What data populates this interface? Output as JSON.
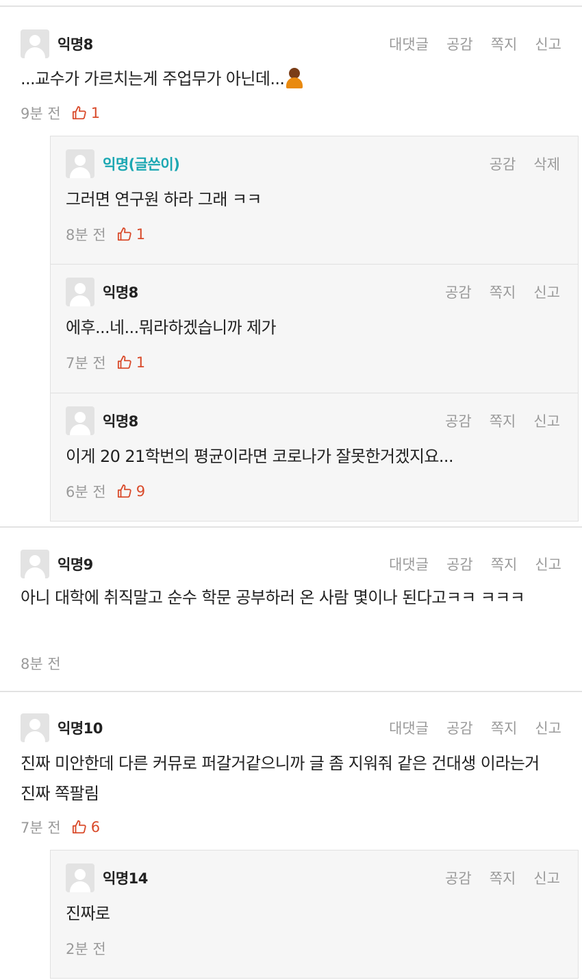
{
  "comments": [
    {
      "author": "익명8",
      "actions": [
        "대댓글",
        "공감",
        "쪽지",
        "신고"
      ],
      "text": "...교수가 가르치는게 주업무가 아닌데...",
      "emoji": "person-shrugging-emoji",
      "time": "9분 전",
      "likes": "1",
      "replies": [
        {
          "author": "익명(글쓴이)",
          "actions": [
            "공감",
            "삭제"
          ],
          "text": "그러면 연구원 하라 그래 ㅋㅋ",
          "time": "8분 전",
          "likes": "1"
        },
        {
          "author": "익명8",
          "actions": [
            "공감",
            "쪽지",
            "신고"
          ],
          "text": "에후...네...뭐라하겠습니까 제가",
          "time": "7분 전",
          "likes": "1"
        },
        {
          "author": "익명8",
          "actions": [
            "공감",
            "쪽지",
            "신고"
          ],
          "text": "이게 20 21학번의 평균이라면 코로나가 잘못한거겠지요...",
          "time": "6분 전",
          "likes": "9"
        }
      ]
    },
    {
      "author": "익명9",
      "actions": [
        "대댓글",
        "공감",
        "쪽지",
        "신고"
      ],
      "text": "아니 대학에 취직말고 순수 학문 공부하러 온 사람 몇이나 된다고ㅋㅋ ㅋㅋㅋ",
      "time": "8분 전"
    },
    {
      "author": "익명10",
      "actions": [
        "대댓글",
        "공감",
        "쪽지",
        "신고"
      ],
      "text": "진짜 미안한데 다른 커뮤로 퍼갈거같으니까 글 좀 지워줘 같은 건대생 이라는거 진짜 쪽팔림",
      "time": "7분 전",
      "likes": "6",
      "replies": [
        {
          "author": "익명14",
          "actions": [
            "공감",
            "쪽지",
            "신고"
          ],
          "text": "진짜로",
          "time": "2분 전"
        }
      ]
    }
  ],
  "colors": {
    "writer": "#1ba7b2",
    "like": "#d94a2a",
    "muted": "#9a9a9a"
  }
}
